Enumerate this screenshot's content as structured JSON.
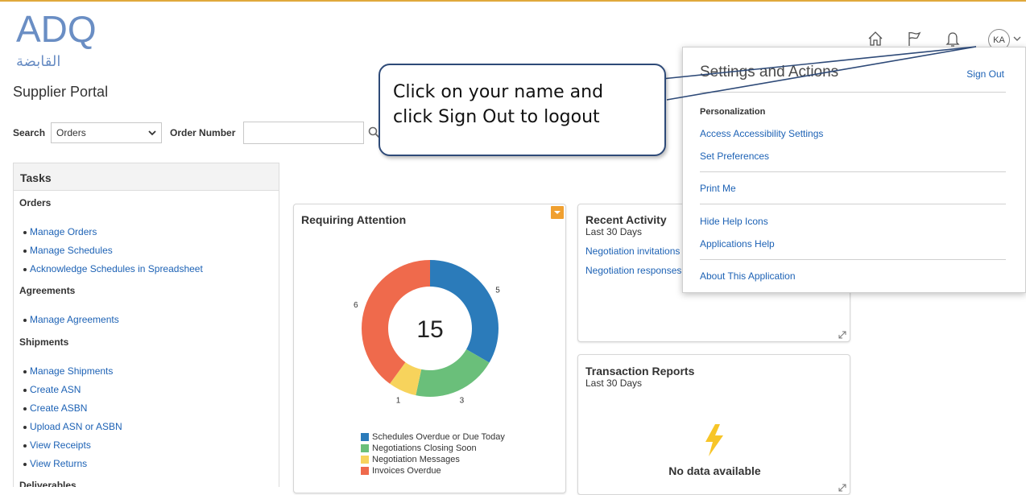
{
  "brand": {
    "logo_text": "ADQ",
    "logo_arabic": "القابضة",
    "portal_title": "Supplier Portal"
  },
  "search": {
    "label": "Search",
    "select_value": "Orders",
    "field_label": "Order Number",
    "placeholder": ""
  },
  "header": {
    "avatar_initials": "KA"
  },
  "tasks": {
    "title": "Tasks",
    "sections": [
      {
        "title": "Orders",
        "links": [
          "Manage Orders",
          "Manage Schedules",
          "Acknowledge Schedules in Spreadsheet"
        ]
      },
      {
        "title": "Agreements",
        "links": [
          "Manage Agreements"
        ]
      },
      {
        "title": "Shipments",
        "links": [
          "Manage Shipments",
          "Create ASN",
          "Create ASBN",
          "Upload ASN or ASBN",
          "View Receipts",
          "View Returns"
        ]
      },
      {
        "title": "Deliverables",
        "links": []
      }
    ]
  },
  "requiring_attention": {
    "title": "Requiring Attention",
    "total": "15",
    "segments": [
      {
        "label": "Schedules Overdue or Due Today",
        "value": 5,
        "color": "#2b7bba"
      },
      {
        "label": "Negotiations Closing Soon",
        "value": 3,
        "color": "#6abf7a"
      },
      {
        "label": "Negotiation Messages",
        "value": 1,
        "color": "#f7d35c"
      },
      {
        "label": "Invoices Overdue",
        "value": 6,
        "color": "#ef6a4c"
      }
    ]
  },
  "recent_activity": {
    "title": "Recent Activity",
    "subtitle": "Last 30 Days",
    "links": [
      "Negotiation invitations",
      "Negotiation responses a"
    ]
  },
  "transaction_reports": {
    "title": "Transaction Reports",
    "subtitle": "Last 30 Days",
    "empty_text": "No data available"
  },
  "settings_popup": {
    "title": "Settings and Actions",
    "sign_out": "Sign Out",
    "personalization_heading": "Personalization",
    "items": {
      "accessibility": "Access Accessibility Settings",
      "preferences": "Set Preferences",
      "print": "Print Me",
      "hide_help": "Hide Help Icons",
      "applications_help": "Applications Help",
      "about": "About This Application"
    }
  },
  "callout": {
    "line1": "Click on your name and",
    "line2": "click Sign Out to logout"
  },
  "colors": {
    "link": "#1d62b5",
    "accent": "#f0a030",
    "callout_border": "#2e4a78"
  }
}
